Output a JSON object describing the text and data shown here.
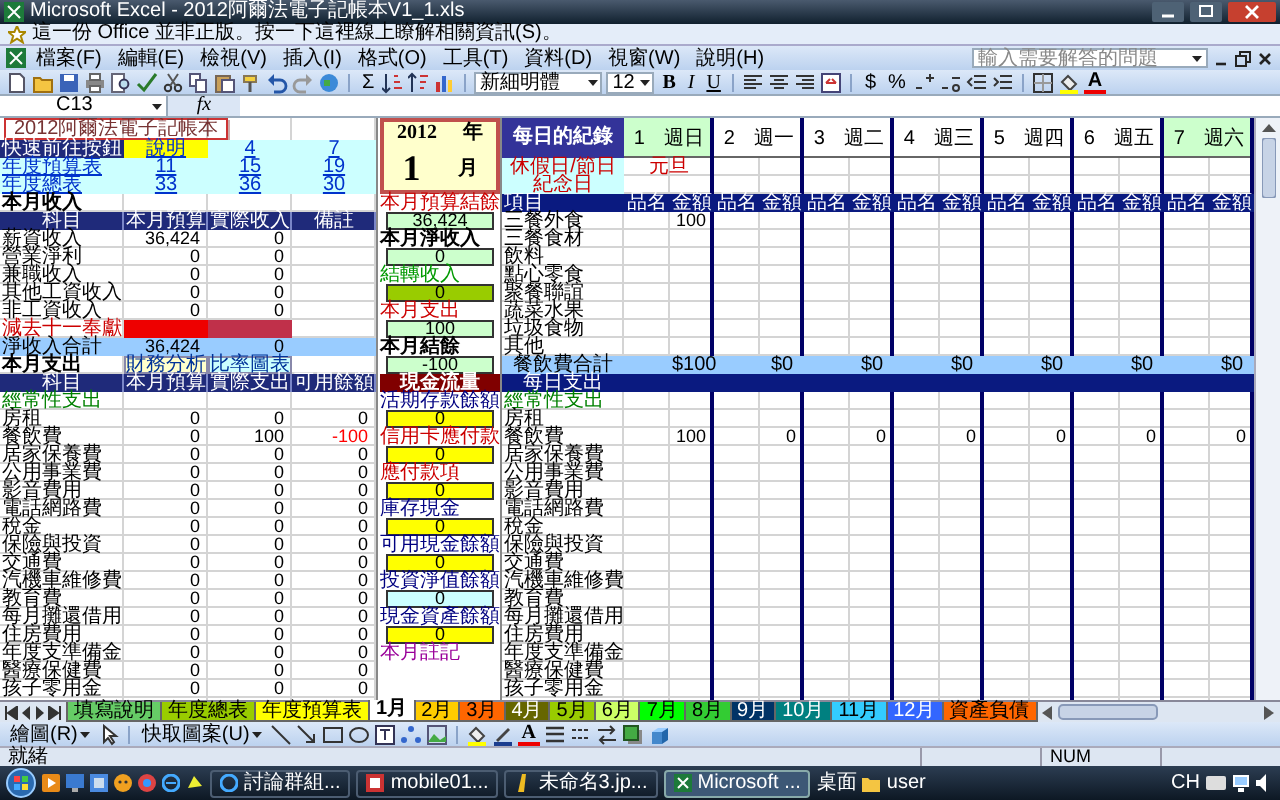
{
  "window": {
    "title": "Microsoft Excel - 2012阿爾法電子記帳本V1_1.xls"
  },
  "info_bar": {
    "text": "這一份 Office 並非正版。按一下這裡線上瞭解相關資訊(S)。"
  },
  "menu": [
    "檔案(F)",
    "編輯(E)",
    "檢視(V)",
    "插入(I)",
    "格式(O)",
    "工具(T)",
    "資料(D)",
    "視窗(W)",
    "說明(H)"
  ],
  "help_box": {
    "placeholder": "輸入需要解答的問題"
  },
  "toolbar": {
    "sum": "Σ",
    "font": "新細明體",
    "size": "12",
    "bold": "B",
    "italic": "I",
    "underline": "U",
    "currency": "$",
    "percent": "%",
    "font_color": "A"
  },
  "formula_bar": {
    "name_box": "C13",
    "function_label": "fx"
  },
  "sheet": {
    "title": "2012阿爾法電子記帳本",
    "quick_links": [
      {
        "label": "快速前往按鈕",
        "kind": "heading",
        "links": [
          {
            "text": "說明",
            "highlighted": true
          },
          {
            "text": "4",
            "highlighted": false
          },
          {
            "text": "7",
            "highlighted": false
          }
        ]
      },
      {
        "label": "年度預算表",
        "kind": "link",
        "links": [
          {
            "text": "11",
            "highlighted": false
          },
          {
            "text": "15",
            "highlighted": false
          },
          {
            "text": "19",
            "highlighted": false
          }
        ]
      },
      {
        "label": "年度總表",
        "kind": "link",
        "links": [
          {
            "text": "33",
            "highlighted": false
          },
          {
            "text": "36",
            "highlighted": false
          },
          {
            "text": "30",
            "highlighted": false
          }
        ]
      }
    ],
    "calendar": {
      "year": "2012",
      "year_unit": "年",
      "month": "1",
      "month_unit": "月"
    },
    "income": {
      "title": "本月收入",
      "columns": [
        "科目",
        "本月預算",
        "實際收入",
        "備註"
      ],
      "rows": [
        {
          "label": "薪資收入",
          "kind": "item",
          "budget": "36,424",
          "actual": "0"
        },
        {
          "label": "營業淨利",
          "kind": "item",
          "budget": "0",
          "actual": "0"
        },
        {
          "label": "兼職收入",
          "kind": "item",
          "budget": "0",
          "actual": "0"
        },
        {
          "label": "其他工資收入",
          "kind": "item",
          "budget": "0",
          "actual": "0"
        },
        {
          "label": "非工資收入",
          "kind": "item",
          "budget": "0",
          "actual": "0"
        },
        {
          "label": "減去十一奉獻",
          "kind": "deduction"
        },
        {
          "label": "淨收入合計",
          "kind": "total",
          "budget": "36,424",
          "actual": "0"
        }
      ]
    },
    "expense": {
      "title": "本月支出",
      "buttons": [
        "財務分析",
        "比率圖表"
      ],
      "columns": [
        "科目",
        "本月預算",
        "實際支出",
        "可用餘額"
      ],
      "rows": [
        {
          "label": "經常性支出",
          "kind": "group"
        },
        {
          "label": "房租",
          "kind": "item",
          "budget": "0",
          "actual": "0",
          "available": "0",
          "overspent": false
        },
        {
          "label": "餐飲費",
          "kind": "item",
          "budget": "0",
          "actual": "100",
          "available": "-100",
          "overspent": true
        },
        {
          "label": "居家保養費",
          "kind": "item",
          "budget": "0",
          "actual": "0",
          "available": "0",
          "overspent": false
        },
        {
          "label": "公用事業費",
          "kind": "item",
          "budget": "0",
          "actual": "0",
          "available": "0",
          "overspent": false
        },
        {
          "label": "影音費用",
          "kind": "item",
          "budget": "0",
          "actual": "0",
          "available": "0",
          "overspent": false
        },
        {
          "label": "電話網路費",
          "kind": "item",
          "budget": "0",
          "actual": "0",
          "available": "0",
          "overspent": false
        },
        {
          "label": "稅金",
          "kind": "item",
          "budget": "0",
          "actual": "0",
          "available": "0",
          "overspent": false
        },
        {
          "label": "保險與投資",
          "kind": "item",
          "budget": "0",
          "actual": "0",
          "available": "0",
          "overspent": false
        },
        {
          "label": "交通費",
          "kind": "item",
          "budget": "0",
          "actual": "0",
          "available": "0",
          "overspent": false
        },
        {
          "label": "汽機車維修費",
          "kind": "item",
          "budget": "0",
          "actual": "0",
          "available": "0",
          "overspent": false
        },
        {
          "label": "教育費",
          "kind": "item",
          "budget": "0",
          "actual": "0",
          "available": "0",
          "overspent": false
        },
        {
          "label": "每月攤還借用",
          "kind": "item",
          "budget": "0",
          "actual": "0",
          "available": "0",
          "overspent": false
        },
        {
          "label": "住房費用",
          "kind": "item",
          "budget": "0",
          "actual": "0",
          "available": "0",
          "overspent": false
        },
        {
          "label": "年度支準備金",
          "kind": "item",
          "budget": "0",
          "actual": "0",
          "available": "0",
          "overspent": false
        },
        {
          "label": "醫療保健費",
          "kind": "item",
          "budget": "0",
          "actual": "0",
          "available": "0",
          "overspent": false
        },
        {
          "label": "孩子零用金",
          "kind": "item",
          "budget": "0",
          "actual": "0",
          "available": "0",
          "overspent": false
        }
      ]
    },
    "summary": [
      {
        "kind": "caption",
        "text": "本月預算結餘",
        "color": "#cc0000"
      },
      {
        "kind": "value",
        "text": "36,424",
        "color": "#ccffcc"
      },
      {
        "kind": "heading",
        "text": "本月淨收入"
      },
      {
        "kind": "value",
        "text": "0",
        "color": "#ccffcc"
      },
      {
        "kind": "caption",
        "text": "結轉收入",
        "color": "#009900"
      },
      {
        "kind": "value",
        "text": "0",
        "color": "#99cc00"
      },
      {
        "kind": "caption",
        "text": "本月支出",
        "color": "#cc0000"
      },
      {
        "kind": "value",
        "text": "100",
        "color": "#ccffcc"
      },
      {
        "kind": "heading",
        "text": "本月結餘"
      },
      {
        "kind": "value",
        "text": "-100",
        "color": "#ccffcc"
      },
      {
        "kind": "banner",
        "text": "現金流量",
        "color": "#800000"
      },
      {
        "kind": "caption",
        "text": "活期存款餘額",
        "color": "#000080"
      },
      {
        "kind": "value",
        "text": "0",
        "color": "#ffff00"
      },
      {
        "kind": "caption",
        "text": "信用卡應付款",
        "color": "#cc0000"
      },
      {
        "kind": "value",
        "text": "0",
        "color": "#ffff00"
      },
      {
        "kind": "caption",
        "text": "應付款項",
        "color": "#cc0000"
      },
      {
        "kind": "value",
        "text": "0",
        "color": "#ffff00"
      },
      {
        "kind": "caption",
        "text": "庫存現金",
        "color": "#000080"
      },
      {
        "kind": "value",
        "text": "0",
        "color": "#ffff00"
      },
      {
        "kind": "caption",
        "text": "可用現金餘額",
        "color": "#000080"
      },
      {
        "kind": "value",
        "text": "0",
        "color": "#ffff00"
      },
      {
        "kind": "caption",
        "text": "投資淨值餘額",
        "color": "#000080"
      },
      {
        "kind": "value",
        "text": "0",
        "color": "#ccffff"
      },
      {
        "kind": "caption",
        "text": "現金資產餘額",
        "color": "#000080"
      },
      {
        "kind": "value",
        "text": "0",
        "color": "#ffff00"
      },
      {
        "kind": "caption",
        "text": "本月註記",
        "color": "#990099"
      }
    ],
    "daily": {
      "title": "每日的紀錄",
      "holiday_label": "休假日/節日",
      "memorial_label": "紀念日",
      "item_header": "項目",
      "days": [
        {
          "day": "1",
          "weekday": "週日",
          "weekend": true,
          "holiday": "元旦",
          "name_header": "品名",
          "amount_header": "金額"
        },
        {
          "day": "2",
          "weekday": "週一",
          "weekend": false,
          "name_header": "品名",
          "amount_header": "金額"
        },
        {
          "day": "3",
          "weekday": "週二",
          "weekend": false,
          "name_header": "品名",
          "amount_header": "金額"
        },
        {
          "day": "4",
          "weekday": "週三",
          "weekend": false,
          "name_header": "品名",
          "amount_header": "金額"
        },
        {
          "day": "5",
          "weekday": "週四",
          "weekend": false,
          "name_header": "品名",
          "amount_header": "金額"
        },
        {
          "day": "6",
          "weekday": "週五",
          "weekend": false,
          "name_header": "品名",
          "amount_header": "金額"
        },
        {
          "day": "7",
          "weekday": "週六",
          "weekend": true,
          "name_header": "品名",
          "amount_header": "金額"
        }
      ],
      "food_rows": [
        {
          "label": "三餐外食",
          "amounts": [
            "100"
          ]
        },
        {
          "label": "三餐食材"
        },
        {
          "label": "飲料"
        },
        {
          "label": "點心零食"
        },
        {
          "label": "聚餐聯誼"
        },
        {
          "label": "蔬菜水果"
        },
        {
          "label": "垃圾食物"
        },
        {
          "label": "其他"
        }
      ],
      "food_total": {
        "label": "餐飲費合計",
        "amounts": [
          "$100",
          "$0",
          "$0",
          "$0",
          "$0",
          "$0",
          "$0"
        ]
      },
      "expense_title": "每日支出",
      "expense_rows": [
        {
          "label": "經常性支出",
          "kind": "group"
        },
        {
          "label": "房租",
          "kind": "item"
        },
        {
          "label": "餐飲費",
          "kind": "item",
          "amounts": [
            "100",
            "0",
            "0",
            "0",
            "0",
            "0",
            "0"
          ]
        },
        {
          "label": "居家保養費",
          "kind": "item"
        },
        {
          "label": "公用事業費",
          "kind": "item"
        },
        {
          "label": "影音費用",
          "kind": "item"
        },
        {
          "label": "電話網路費",
          "kind": "item"
        },
        {
          "label": "稅金",
          "kind": "item"
        },
        {
          "label": "保險與投資",
          "kind": "item"
        },
        {
          "label": "交通費",
          "kind": "item"
        },
        {
          "label": "汽機車維修費",
          "kind": "item"
        },
        {
          "label": "教育費",
          "kind": "item"
        },
        {
          "label": "每月攤還借用",
          "kind": "item"
        },
        {
          "label": "住房費用",
          "kind": "item"
        },
        {
          "label": "年度支準備金",
          "kind": "item"
        },
        {
          "label": "醫療保健費",
          "kind": "item"
        },
        {
          "label": "孩子零用金",
          "kind": "item"
        }
      ]
    }
  },
  "sheet_tabs": [
    {
      "label": "填寫說明",
      "color": "#66cc66",
      "selected": false
    },
    {
      "label": "年度總表",
      "color": "#99cc00",
      "selected": false
    },
    {
      "label": "年度預算表",
      "color": "#ffff00",
      "selected": false
    },
    {
      "label": "1月",
      "color": "#ffffff",
      "selected": true
    },
    {
      "label": "2月",
      "color": "#ffcc00",
      "selected": false
    },
    {
      "label": "3月",
      "color": "#ff6600",
      "selected": false
    },
    {
      "label": "4月",
      "color": "#666600",
      "selected": false
    },
    {
      "label": "5月",
      "color": "#99cc00",
      "selected": false
    },
    {
      "label": "6月",
      "color": "#ccff66",
      "selected": false
    },
    {
      "label": "7月",
      "color": "#00ff00",
      "selected": false
    },
    {
      "label": "8月",
      "color": "#33cc33",
      "selected": false
    },
    {
      "label": "9月",
      "color": "#003366",
      "selected": false
    },
    {
      "label": "10月",
      "color": "#008080",
      "selected": false
    },
    {
      "label": "11月",
      "color": "#33ccff",
      "selected": false
    },
    {
      "label": "12月",
      "color": "#3366ff",
      "selected": false
    },
    {
      "label": "資產負債",
      "color": "#ff6600",
      "selected": false
    }
  ],
  "drawing_toolbar": {
    "draw": "繪圖(R)",
    "autoshapes": "快取圖案(U)",
    "font_color": "A"
  },
  "status_bar": {
    "text": "就緒",
    "num": "NUM"
  },
  "taskbar": {
    "tasks": [
      {
        "label": "討論群組...",
        "selected": false
      },
      {
        "label": "mobile01...",
        "selected": false
      },
      {
        "label": "未命名3.jp...",
        "selected": false
      },
      {
        "label": "Microsoft ...",
        "selected": true
      }
    ],
    "desktop": "桌面",
    "user": "user",
    "language": "CH"
  }
}
